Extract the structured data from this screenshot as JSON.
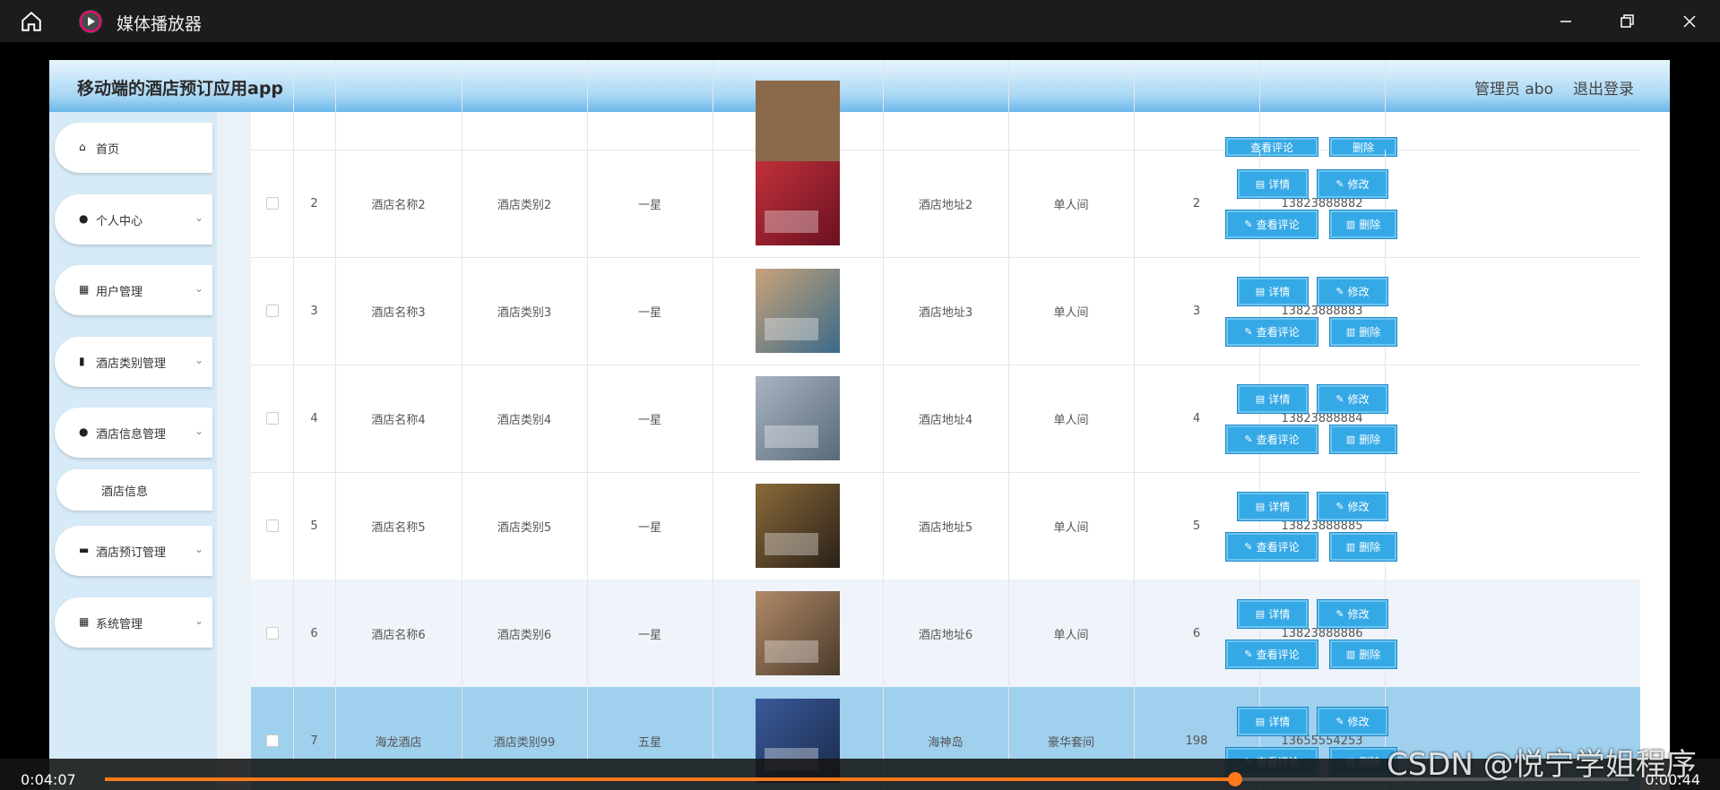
{
  "player": {
    "title": "媒体播放器",
    "current_time": "0:04:07",
    "duration": "0:00:44",
    "progress": 0.742
  },
  "app": {
    "title": "移动端的酒店预订应用app",
    "user": "管理员 abo",
    "logout": "退出登录"
  },
  "sidebar": {
    "items": [
      {
        "label": "首页",
        "icon": "home-icon"
      },
      {
        "label": "个人中心",
        "icon": "user-icon"
      },
      {
        "label": "用户管理",
        "icon": "grid-icon"
      },
      {
        "label": "酒店类别管理",
        "icon": "book-icon"
      },
      {
        "label": "酒店信息管理",
        "icon": "location-icon"
      },
      {
        "label": "酒店信息",
        "icon": ""
      },
      {
        "label": "酒店预订管理",
        "icon": "laptop-icon"
      },
      {
        "label": "系统管理",
        "icon": "grid-icon"
      }
    ]
  },
  "buttons": {
    "detail": "详情",
    "edit": "修改",
    "review": "查看评论",
    "delete": "删除"
  },
  "rows": [
    {
      "index": "2",
      "name": "酒店名称2",
      "category": "酒店类别2",
      "star": "一星",
      "address": "酒店地址2",
      "room": "单人间",
      "count": "2",
      "phone": "13823888882"
    },
    {
      "index": "3",
      "name": "酒店名称3",
      "category": "酒店类别3",
      "star": "一星",
      "address": "酒店地址3",
      "room": "单人间",
      "count": "3",
      "phone": "13823888883"
    },
    {
      "index": "4",
      "name": "酒店名称4",
      "category": "酒店类别4",
      "star": "一星",
      "address": "酒店地址4",
      "room": "单人间",
      "count": "4",
      "phone": "13823888884"
    },
    {
      "index": "5",
      "name": "酒店名称5",
      "category": "酒店类别5",
      "star": "一星",
      "address": "酒店地址5",
      "room": "单人间",
      "count": "5",
      "phone": "13823888885"
    },
    {
      "index": "6",
      "name": "酒店名称6",
      "category": "酒店类别6",
      "star": "一星",
      "address": "酒店地址6",
      "room": "单人间",
      "count": "6",
      "phone": "13823888886"
    },
    {
      "index": "7",
      "name": "海龙酒店",
      "category": "酒店类别99",
      "star": "五星",
      "address": "海神岛",
      "room": "豪华套间",
      "count": "198",
      "phone": "13655554253"
    }
  ],
  "watermark": "CSDN @悦宁学姐程序"
}
